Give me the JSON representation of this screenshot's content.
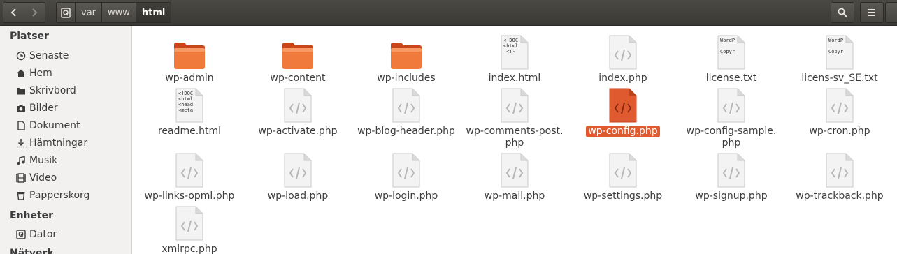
{
  "toolbar": {
    "back_icon": "chevron-left-icon",
    "forward_icon": "chevron-right-icon",
    "breadcrumb": [
      "var",
      "www",
      "html"
    ],
    "search_icon": "search-icon",
    "menu_icon": "menu-icon"
  },
  "sidebar": {
    "places_heading": "Platser",
    "places": [
      {
        "label": "Senaste",
        "icon": "clock-icon"
      },
      {
        "label": "Hem",
        "icon": "home-icon"
      },
      {
        "label": "Skrivbord",
        "icon": "folder-icon"
      },
      {
        "label": "Bilder",
        "icon": "camera-icon"
      },
      {
        "label": "Dokument",
        "icon": "document-icon"
      },
      {
        "label": "Hämtningar",
        "icon": "download-icon"
      },
      {
        "label": "Musik",
        "icon": "music-icon"
      },
      {
        "label": "Video",
        "icon": "film-icon"
      },
      {
        "label": "Papperskorg",
        "icon": "trash-icon"
      }
    ],
    "devices_heading": "Enheter",
    "devices": [
      {
        "label": "Dator",
        "icon": "drive-icon"
      }
    ],
    "network_heading": "Nätverk"
  },
  "files": [
    {
      "name": "wp-admin",
      "type": "folder"
    },
    {
      "name": "wp-content",
      "type": "folder"
    },
    {
      "name": "wp-includes",
      "type": "folder"
    },
    {
      "name": "index.html",
      "type": "html",
      "snippet": "<!DOC\n<html\n <!-"
    },
    {
      "name": "index.php",
      "type": "php"
    },
    {
      "name": "license.txt",
      "type": "text",
      "snippet": "WordP\n\nCopyr"
    },
    {
      "name": "licens-sv_SE.txt",
      "type": "text",
      "snippet": "WordP\n\nCopyr"
    },
    {
      "name": "readme.html",
      "type": "html",
      "snippet": "<!DOC\n<html\n<head\n<meta"
    },
    {
      "name": "wp-activate.php",
      "type": "php"
    },
    {
      "name": "wp-blog-header.php",
      "type": "php"
    },
    {
      "name": "wp-comments-post.\nphp",
      "type": "php"
    },
    {
      "name": "wp-config.php",
      "type": "php",
      "selected": true
    },
    {
      "name": "wp-config-sample.\nphp",
      "type": "php"
    },
    {
      "name": "wp-cron.php",
      "type": "php"
    },
    {
      "name": "wp-links-opml.php",
      "type": "php"
    },
    {
      "name": "wp-load.php",
      "type": "php"
    },
    {
      "name": "wp-login.php",
      "type": "php"
    },
    {
      "name": "wp-mail.php",
      "type": "php"
    },
    {
      "name": "wp-settings.php",
      "type": "php"
    },
    {
      "name": "wp-signup.php",
      "type": "php"
    },
    {
      "name": "wp-trackback.php",
      "type": "php"
    },
    {
      "name": "xmlrpc.php",
      "type": "php"
    }
  ],
  "colors": {
    "accent": "#e05a30",
    "folder": "#f07a3c",
    "header": "#403f3b",
    "sidebar": "#f2f1f0"
  }
}
